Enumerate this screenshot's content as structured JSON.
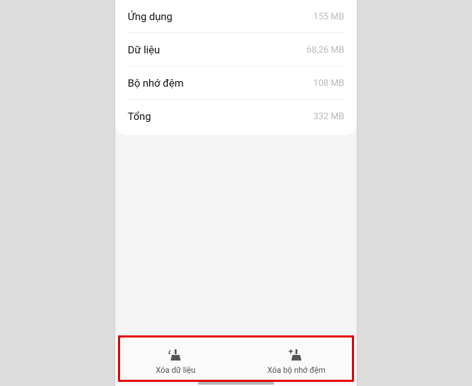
{
  "storage": {
    "rows": [
      {
        "label": "Ứng dụng",
        "value": "155 MB"
      },
      {
        "label": "Dữ liệu",
        "value": "68,26 MB"
      },
      {
        "label": "Bộ nhớ đệm",
        "value": "108 MB"
      },
      {
        "label": "Tổng",
        "value": "332 MB"
      }
    ]
  },
  "actions": {
    "clear_data": "Xóa dữ liệu",
    "clear_cache": "Xóa bộ nhớ đệm"
  },
  "icons": {
    "broom_reset": "broom-reset-icon",
    "broom_plus": "broom-plus-icon"
  }
}
